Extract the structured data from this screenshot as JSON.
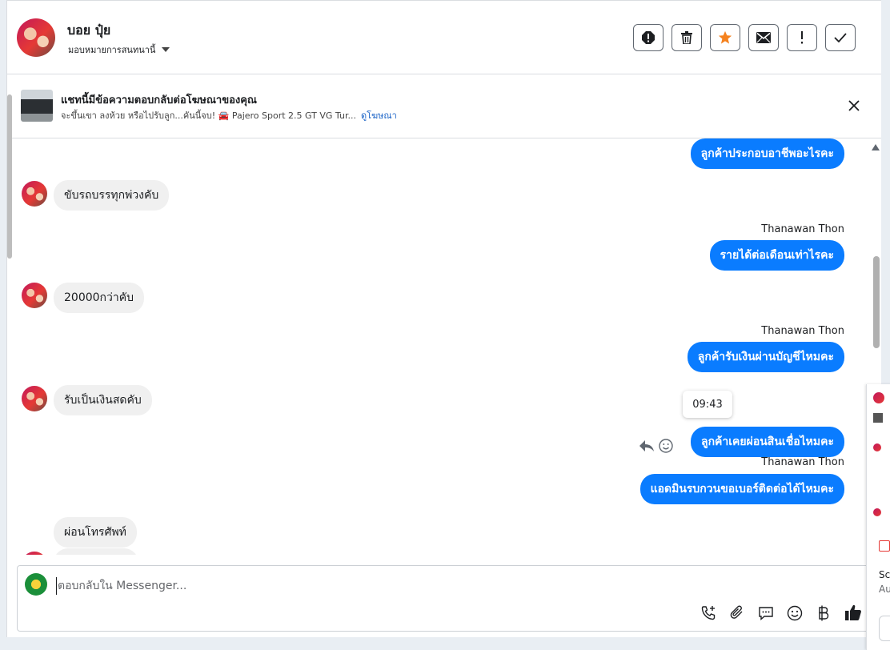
{
  "header": {
    "contact_name": "บอย ปุ๋ย",
    "assign_label": "มอบหมายการสนทนานี้"
  },
  "ad": {
    "title": "แชทนี้มีข้อความตอบกลับต่อโฆษณาของคุณ",
    "caption": "จะขึ้นเขา ลงห้วย หรือไปรับลูก...คันนี้จบ! 🚘 Pajero Sport 2.5 GT VG Tur...",
    "link": "ดูโฆษณา"
  },
  "thread": {
    "out1": "ลูกค้าประกอบอาชีพอะไรคะ",
    "in1": "ขับรถบรรทุกพ่วงคับ",
    "sender1": "Thanawan Thon",
    "out2": "รายได้ต่อเดือนเท่าไรคะ",
    "in2": "20000กว่าคับ",
    "sender2": "Thanawan Thon",
    "out3": "ลูกค้ารับเงินผ่านบัญชีไหมคะ",
    "in3": "รับเป็นเงินสดคับ",
    "tooltip_time": "09:43",
    "out4": "ลูกค้าเคยผ่อนสินเชื่อไหมคะ",
    "sender3": "Thanawan Thon",
    "out5": "แอดมินรบกวนขอเบอร์ติดต่อได้ไหมคะ",
    "in4": "ผ่อนโทรศัพท์"
  },
  "composer": {
    "placeholder": "ตอบกลับใน Messenger..."
  },
  "side_panel": {
    "line1": "Sc",
    "line2": "Au"
  },
  "colors": {
    "outgoing_bubble": "#0a7cff",
    "incoming_bubble": "#f0f0f0",
    "star": "#f5821f",
    "link": "#1a63c7"
  },
  "icons": [
    "spam-icon",
    "trash-icon",
    "star-icon",
    "envelope-icon",
    "important-icon",
    "check-icon",
    "close-icon",
    "reply-icon",
    "emoji-icon",
    "add-call-icon",
    "paperclip-icon",
    "saved-reply-icon",
    "emoji-icon",
    "baht-icon",
    "thumbs-up-icon"
  ]
}
